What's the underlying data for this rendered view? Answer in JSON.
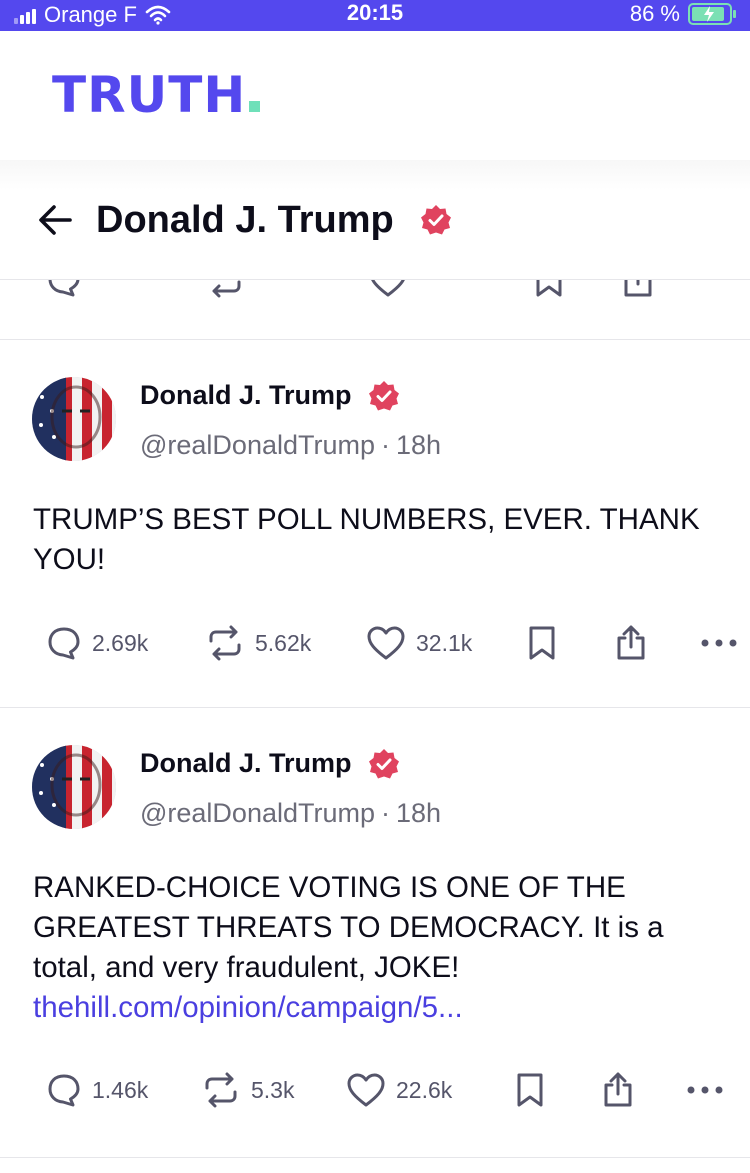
{
  "status_bar": {
    "carrier": "Orange F",
    "time": "20:15",
    "battery": "86 %"
  },
  "brand": {
    "logo_text": "TRUTH"
  },
  "profile_nav": {
    "title": "Donald J. Trump"
  },
  "posts": [
    {
      "author_name": "Donald J. Trump",
      "handle": "@realDonaldTrump",
      "separator": "·",
      "time_ago": "18h",
      "text": "TRUMP’S BEST POLL NUMBERS, EVER. THANK YOU!",
      "link": "",
      "replies": "2.69k",
      "retruths": "5.62k",
      "likes": "32.1k"
    },
    {
      "author_name": "Donald J. Trump",
      "handle": "@realDonaldTrump",
      "separator": "·",
      "time_ago": "18h",
      "text": "RANKED-CHOICE VOTING IS ONE OF THE GREATEST THREATS TO DEMOCRACY. It is a total, and very fraudulent, JOKE!",
      "link": "thehill.com/opinion/campaign/5...",
      "replies": "1.46k",
      "retruths": "5.3k",
      "likes": "22.6k"
    }
  ],
  "colors": {
    "status_bar": "#5448ee",
    "brand": "#5448ee",
    "brand_accent": "#6fe0b9",
    "verified": "#e0435f",
    "link": "#4a3fe0"
  }
}
